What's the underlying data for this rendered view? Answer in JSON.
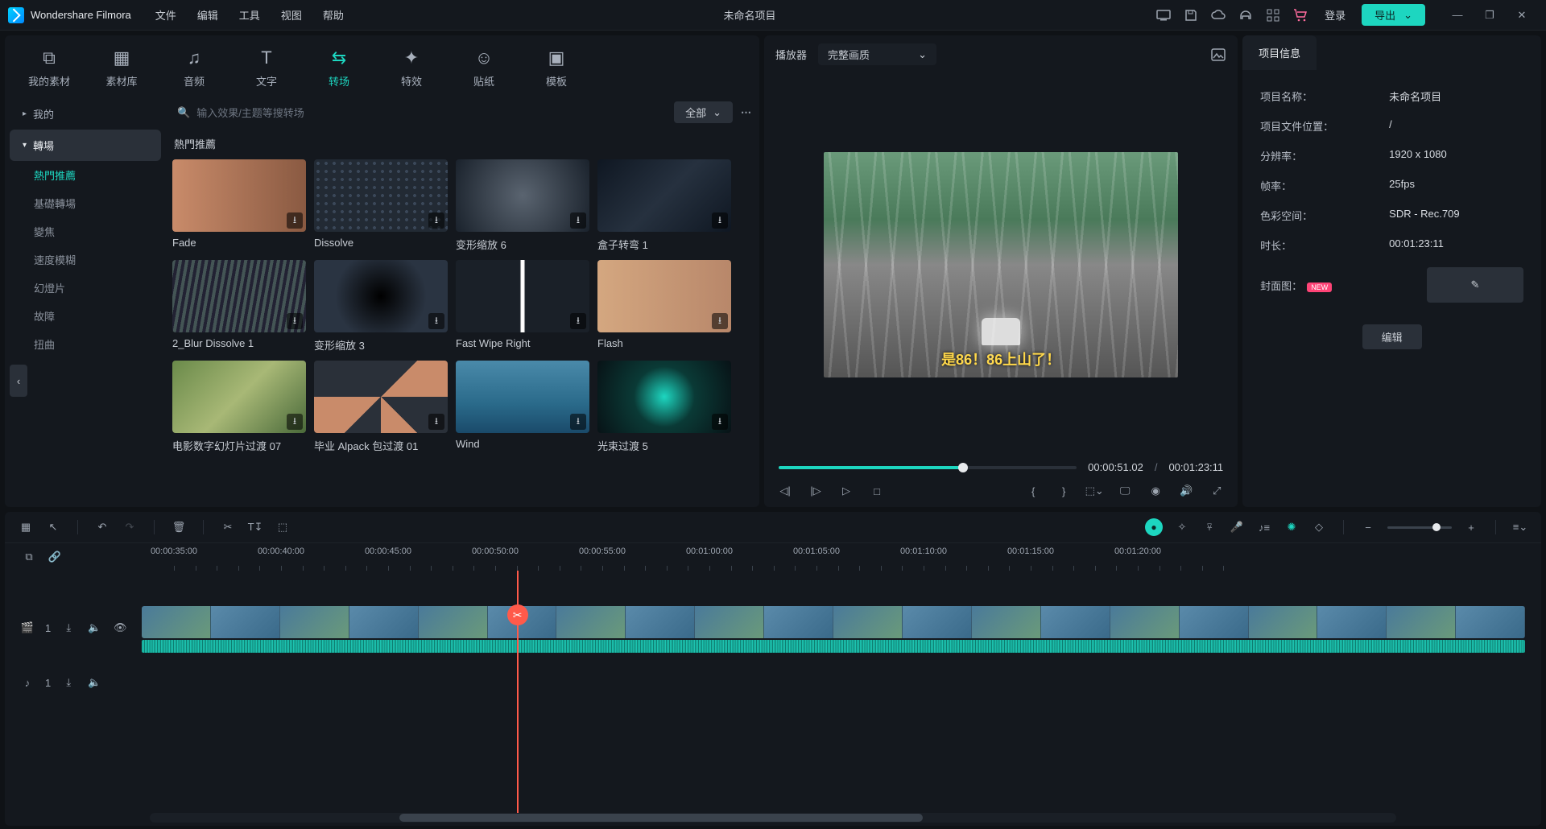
{
  "app_name": "Wondershare Filmora",
  "project_title": "未命名项目",
  "menu": [
    "文件",
    "编辑",
    "工具",
    "视图",
    "帮助"
  ],
  "login_label": "登录",
  "export_label": "导出",
  "asset_tabs": [
    {
      "label": "我的素材",
      "icon": "media"
    },
    {
      "label": "素材库",
      "icon": "grid"
    },
    {
      "label": "音频",
      "icon": "music"
    },
    {
      "label": "文字",
      "icon": "text"
    },
    {
      "label": "转场",
      "icon": "transition",
      "active": true
    },
    {
      "label": "特效",
      "icon": "sparkle"
    },
    {
      "label": "贴纸",
      "icon": "sticker"
    },
    {
      "label": "模板",
      "icon": "template"
    }
  ],
  "search_placeholder": "输入效果/主题等搜转场",
  "filter_all": "全部",
  "side": {
    "groups": [
      {
        "label": "我的",
        "expand": "▸"
      },
      {
        "label": "轉場",
        "expand": "▾",
        "sel": true
      }
    ],
    "subs": [
      "熱門推薦",
      "基礎轉場",
      "變焦",
      "速度模糊",
      "幻燈片",
      "故障",
      "扭曲"
    ]
  },
  "section_title": "熱門推薦",
  "thumbs": [
    {
      "label": "Fade",
      "cls": "tfade"
    },
    {
      "label": "Dissolve",
      "cls": "tdis"
    },
    {
      "label": "变形缩放 6",
      "cls": "tzoom"
    },
    {
      "label": "盒子转弯 1",
      "cls": "tbox"
    },
    {
      "label": "2_Blur Dissolve 1",
      "cls": "tblur"
    },
    {
      "label": "变形缩放 3",
      "cls": "tzoom3"
    },
    {
      "label": "Fast Wipe Right",
      "cls": "twipe"
    },
    {
      "label": "Flash",
      "cls": "tflash"
    },
    {
      "label": "电影数字幻灯片过渡 07",
      "cls": "tmov"
    },
    {
      "label": "毕业 Alpack 包过渡 01",
      "cls": "talp"
    },
    {
      "label": "Wind",
      "cls": "twind"
    },
    {
      "label": "光束过渡 5",
      "cls": "tbeam"
    }
  ],
  "player": {
    "label": "播放器",
    "quality": "完整画质",
    "subtitle": "是86！86上山了！",
    "time_current": "00:00:51.02",
    "time_total": "00:01:23:11"
  },
  "info": {
    "tab": "项目信息",
    "rows": {
      "name_k": "项目名称：",
      "name_v": "未命名项目",
      "path_k": "项目文件位置：",
      "path_v": "/",
      "res_k": "分辨率：",
      "res_v": "1920 x 1080",
      "fps_k": "帧率：",
      "fps_v": "25fps",
      "color_k": "色彩空间：",
      "color_v": "SDR - Rec.709",
      "dur_k": "时长：",
      "dur_v": "00:01:23:11",
      "cover_k": "封面图："
    },
    "new_tag": "NEW",
    "edit_btn": "编辑"
  },
  "ruler": [
    "00:00:35:00",
    "00:00:40:00",
    "00:00:45:00",
    "00:00:50:00",
    "00:00:55:00",
    "00:01:00:00",
    "00:01:05:00",
    "00:01:10:00",
    "00:01:15:00",
    "00:01:20:00"
  ],
  "tracks": {
    "video_idx": "1",
    "audio_idx": "1"
  },
  "colors": {
    "accent": "#1dd6c0",
    "danger": "#ff5a4a"
  }
}
